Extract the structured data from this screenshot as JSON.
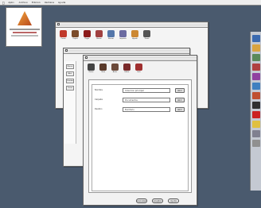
{
  "menubar": {
    "apple": "",
    "items": [
      "Aplic.",
      "Archivo",
      "Edicion",
      "Ventana",
      "Ayuda"
    ]
  },
  "about": {
    "logo": "app-logo-icon"
  },
  "back_window": {
    "tools": [
      {
        "label": "Cortar",
        "color": "#c0392b"
      },
      {
        "label": "Copiar",
        "color": "#7a4b2a"
      },
      {
        "label": "Pegar",
        "color": "#8b1a1a"
      },
      {
        "label": "Borrar",
        "color": "#a04040"
      },
      {
        "label": "Buscar",
        "color": "#5577aa"
      },
      {
        "label": "Imprimir",
        "color": "#6a6aa0"
      },
      {
        "label": "Ayuda",
        "color": "#cc8833"
      },
      {
        "label": "Zoom",
        "color": "#555555"
      }
    ]
  },
  "middle_window": {
    "sidebar_buttons": [
      "Nuevo",
      "Abrir",
      "Guardar",
      "Cerrar"
    ]
  },
  "main_window": {
    "tools": [
      {
        "label": "Datos",
        "color": "#444444"
      },
      {
        "label": "Obra",
        "color": "#5a3a2a"
      },
      {
        "label": "Autor",
        "color": "#6b4a3a"
      },
      {
        "label": "Editar",
        "color": "#7a2a2a"
      },
      {
        "label": "Salir",
        "color": "#a03030"
      }
    ],
    "rows": [
      {
        "label": "Nombre",
        "value": "Coleccion principal",
        "button": "Abrir"
      },
      {
        "label": "Carpeta",
        "value": "Documentos",
        "button": "Abrir"
      },
      {
        "label": "Destino",
        "value": "Escritorio",
        "button": "Abrir"
      }
    ],
    "footer_buttons": [
      "Cancelar",
      "Aceptar",
      "Ayuda"
    ]
  },
  "dock": {
    "items": [
      {
        "name": "globe-icon",
        "color": "#3a6ab0"
      },
      {
        "name": "folder-icon",
        "color": "#d9a441"
      },
      {
        "name": "mail-icon",
        "color": "#5a8a5a"
      },
      {
        "name": "paint-icon",
        "color": "#b04040"
      },
      {
        "name": "music-icon",
        "color": "#9040a0"
      },
      {
        "name": "photo-icon",
        "color": "#4080c0"
      },
      {
        "name": "calendar-icon",
        "color": "#c05030"
      },
      {
        "name": "movie-icon",
        "color": "#303030"
      },
      {
        "name": "alert-icon",
        "color": "#cc2222"
      },
      {
        "name": "notes-icon",
        "color": "#e0c040"
      },
      {
        "name": "settings-icon",
        "color": "#808090"
      },
      {
        "name": "trash-icon",
        "color": "#909090"
      }
    ]
  }
}
